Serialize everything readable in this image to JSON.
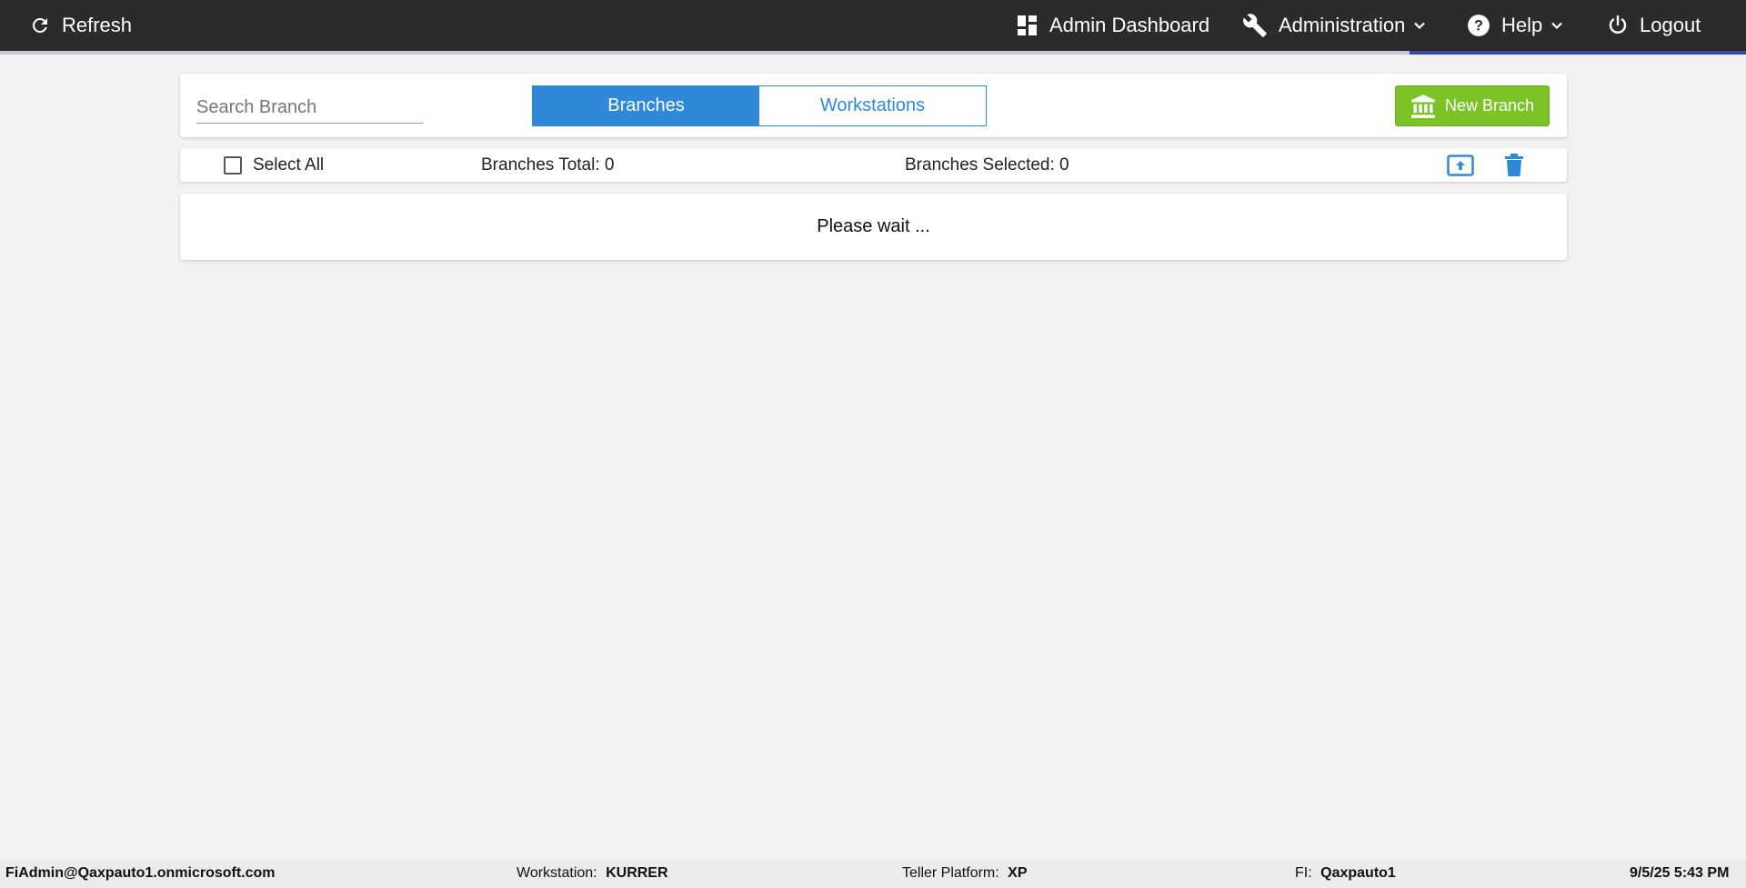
{
  "topbar": {
    "refresh_label": "Refresh",
    "admin_dashboard_label": "Admin Dashboard",
    "administration_label": "Administration",
    "help_label": "Help",
    "logout_label": "Logout"
  },
  "toolbar": {
    "search_placeholder": "Search Branch",
    "search_value": "",
    "tabs": [
      {
        "label": "Branches",
        "active": true
      },
      {
        "label": "Workstations",
        "active": false
      }
    ],
    "new_branch_label": "New Branch"
  },
  "summary": {
    "select_all_label": "Select All",
    "total_label": "Branches Total: 0",
    "selected_label": "Branches Selected: 0"
  },
  "content": {
    "status_text": "Please wait ..."
  },
  "footer": {
    "user": "FiAdmin@Qaxpauto1.onmicrosoft.com",
    "workstation_label": "Workstation:",
    "workstation_value": "KURRER",
    "platform_label": "Teller Platform:",
    "platform_value": "XP",
    "fi_label": "FI:",
    "fi_value": "Qaxpauto1",
    "datetime": "9/5/25 5:43 PM"
  },
  "colors": {
    "topbar": "#2b2b2b",
    "accent_blue": "#2f88d8",
    "new_branch_green": "#7cc327",
    "progress_indigo": "#3949ab"
  },
  "icons": {
    "refresh": "refresh-icon",
    "dashboard": "dashboard-grid-icon",
    "administration": "wrench-icon",
    "help": "help-circle-icon",
    "logout": "power-icon",
    "new_branch": "bank-icon",
    "upload": "upload-icon",
    "delete": "trash-icon"
  }
}
